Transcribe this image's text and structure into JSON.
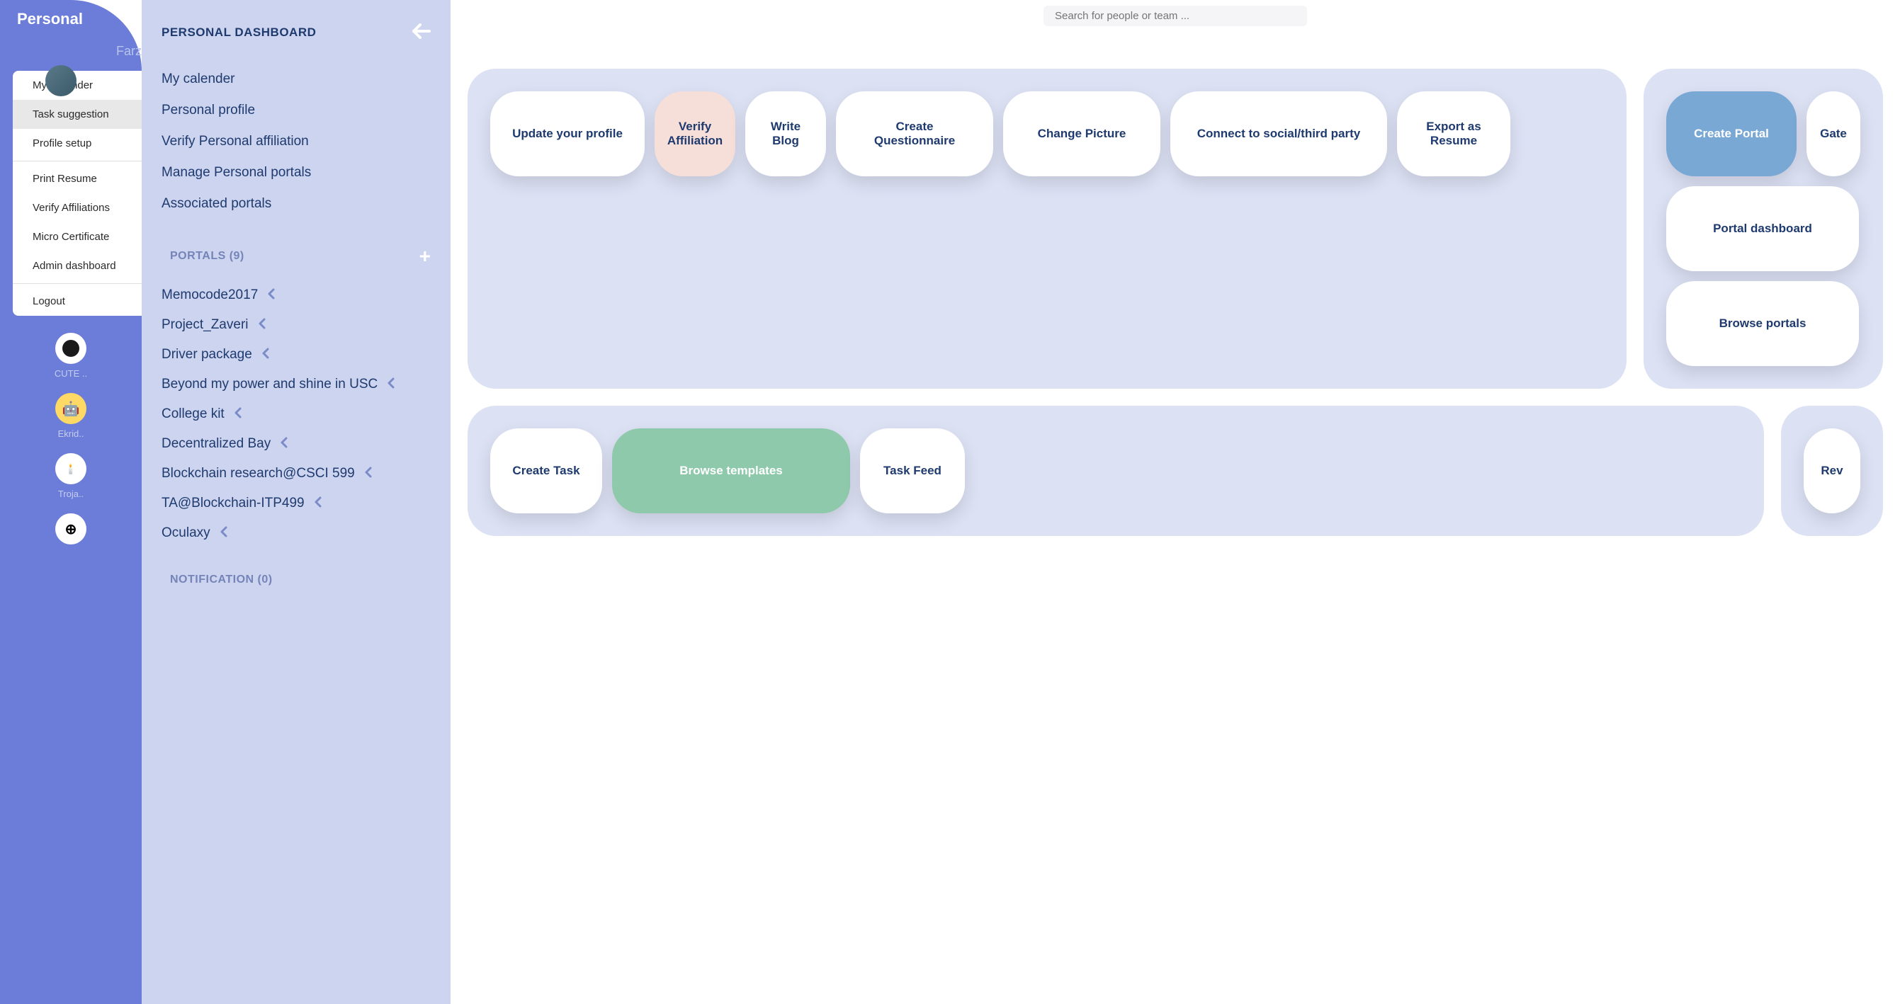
{
  "sidebar": {
    "title": "Personal",
    "userName": "Farzad",
    "menu": [
      {
        "label": "My Calender"
      },
      {
        "label": "Task suggestion",
        "selected": true
      },
      {
        "label": "Profile setup"
      },
      {
        "label": "Print Resume"
      },
      {
        "label": "Verify Affiliations"
      },
      {
        "label": "Micro Certificate"
      },
      {
        "label": "Admin dashboard"
      },
      {
        "label": "Logout"
      }
    ],
    "avatars": [
      {
        "label": "CUTE .."
      },
      {
        "label": "Ekrid.."
      },
      {
        "label": "Troja.."
      },
      {
        "label": ""
      }
    ]
  },
  "panel": {
    "title": "PERSONAL DASHBOARD",
    "links": [
      "My calender",
      "Personal profile",
      "Verify Personal affiliation",
      "Manage Personal portals",
      "Associated portals"
    ],
    "portalsHeader": "PORTALS  (9)",
    "portals": [
      "Memocode2017",
      "Project_Zaveri",
      "Driver package",
      "Beyond my power and shine in USC",
      "College kit",
      "Decentralized Bay",
      "Blockchain research@CSCI 599",
      "TA@Blockchain-ITP499",
      "Oculaxy"
    ],
    "notificationHeader": "NOTIFICATION  (0)"
  },
  "search": {
    "placeholder": "Search for people or team ..."
  },
  "cards": {
    "group1": {
      "updateProfile": "Update your profile",
      "verifyAffiliation": "Verify Affiliation",
      "writeBlog": "Write Blog",
      "createQuestionnaire": "Create Questionnaire",
      "changePicture": "Change Picture",
      "connectSocial": "Connect to social/third party",
      "exportResume": "Export as Resume"
    },
    "group2": {
      "createPortal": "Create Portal",
      "gate": "Gate",
      "portalDashboard": "Portal dashboard",
      "browsePortals": "Browse portals"
    },
    "group3": {
      "createTask": "Create Task",
      "browseTemplates": "Browse templates",
      "taskFeed": "Task Feed"
    },
    "group4": {
      "rev": "Rev"
    }
  }
}
